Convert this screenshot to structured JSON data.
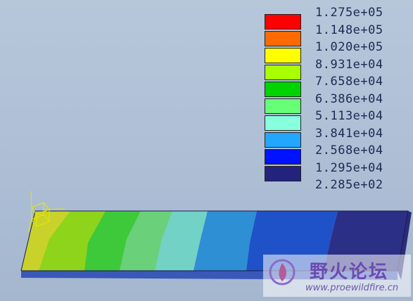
{
  "legend": {
    "labels": [
      "1.275e+05",
      "1.148e+05",
      "1.020e+05",
      "8.931e+04",
      "7.658e+04",
      "6.386e+04",
      "5.113e+04",
      "3.841e+04",
      "2.568e+04",
      "1.295e+04",
      "2.285e+02"
    ],
    "colors": [
      "#ff0000",
      "#ff6a00",
      "#ffff00",
      "#a8ff00",
      "#00d400",
      "#66ff77",
      "#88ffdd",
      "#22a6ff",
      "#0012ff",
      "#23237e"
    ]
  },
  "model": {
    "band_colors": [
      "#c8d22a",
      "#8ed41a",
      "#3ec93a",
      "#6ad07a",
      "#72d2c6",
      "#2e8fd4",
      "#1f52c8",
      "#2c2f86"
    ]
  },
  "watermark": {
    "title": "野火论坛",
    "url": "www.proewildfire.cn"
  }
}
